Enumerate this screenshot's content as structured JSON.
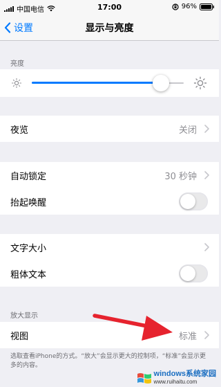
{
  "status_bar": {
    "carrier": "中国电信",
    "time": "17:00",
    "battery": "96%"
  },
  "nav": {
    "back_label": "设置",
    "title": "显示与亮度"
  },
  "brightness": {
    "header": "亮度",
    "level": 0.85
  },
  "night_shift": {
    "label": "夜览",
    "value": "关闭"
  },
  "auto_lock": {
    "label": "自动锁定",
    "value": "30 秒钟"
  },
  "raise_to_wake": {
    "label": "抬起唤醒",
    "enabled": false
  },
  "text_size": {
    "label": "文字大小"
  },
  "bold_text": {
    "label": "粗体文本",
    "enabled": false
  },
  "zoom": {
    "header": "放大显示",
    "view_label": "视图",
    "view_value": "标准",
    "footer": "选取查看iPhone的方式。“放大”会显示更大的控制项，“标准”会显示更多的内容。"
  },
  "watermark": {
    "brand": "windows系统家园",
    "url": "www.ruihaitu.com"
  },
  "colors": {
    "accent": "#007aff",
    "arrow": "#e6232e",
    "background": "#efeff4"
  }
}
